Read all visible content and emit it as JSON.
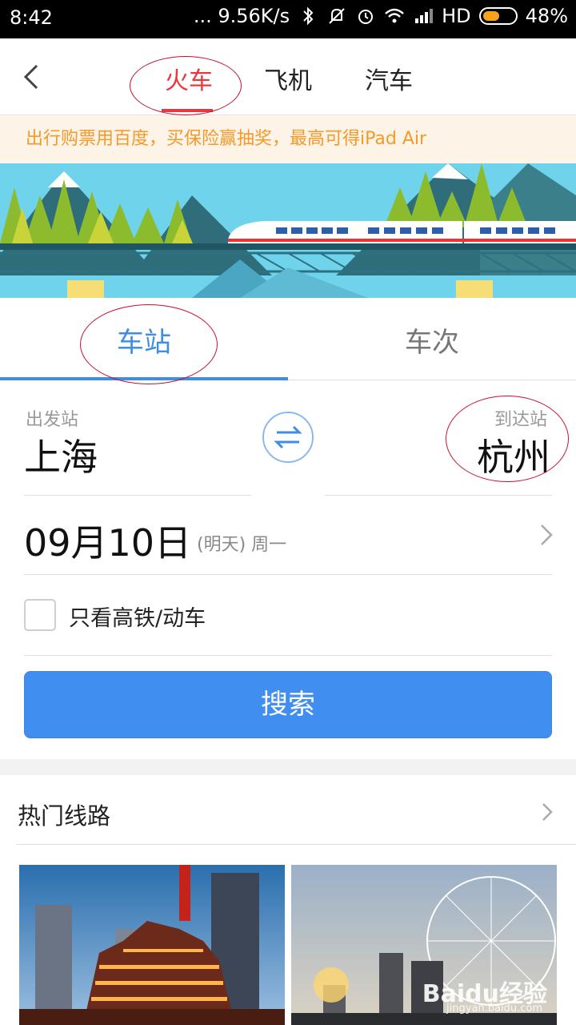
{
  "status_bar": {
    "time": "8:42",
    "network_speed": "... 9.56K/s",
    "network_type": "HD",
    "battery": "48%"
  },
  "nav": {
    "tabs": [
      {
        "label": "火车",
        "active": true
      },
      {
        "label": "飞机",
        "active": false
      },
      {
        "label": "汽车",
        "active": false
      }
    ]
  },
  "promo": {
    "text": "出行购票用百度，买保险赢抽奖，最高可得iPad Air"
  },
  "search_tabs": {
    "station": "车站",
    "train_no": "车次"
  },
  "route": {
    "from_label": "出发站",
    "from_city": "上海",
    "to_label": "到达站",
    "to_city": "杭州"
  },
  "date": {
    "value": "09月10日",
    "note": "(明天) 周一"
  },
  "filter": {
    "label": "只看高铁/动车",
    "checked": false
  },
  "search_button": "搜索",
  "hot_routes": {
    "title": "热门线路"
  },
  "watermark": {
    "brand": "Baidu经验",
    "url": "jingyan.baidu.com"
  },
  "colors": {
    "accent_red": "#e8383d",
    "accent_blue": "#3f8ef0",
    "promo_text": "#f39a2b"
  }
}
